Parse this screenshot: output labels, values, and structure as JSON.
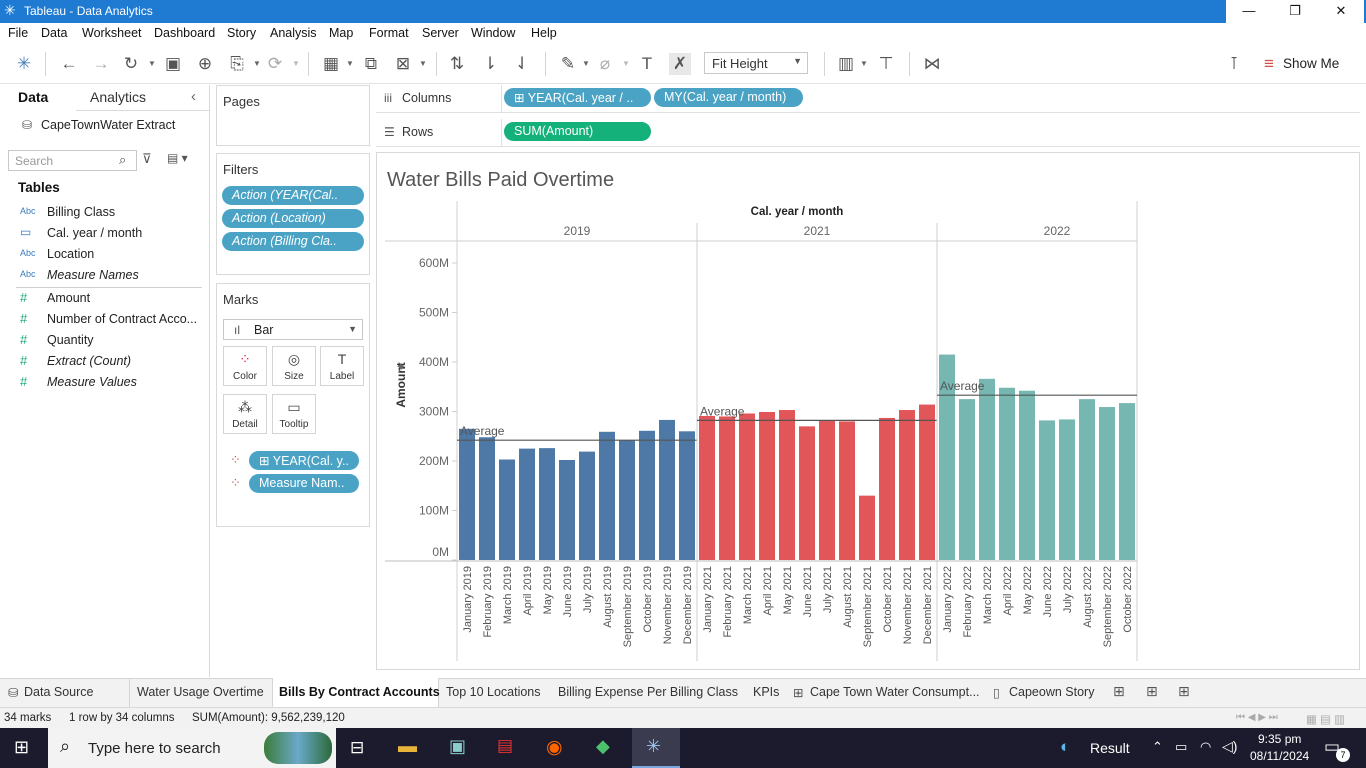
{
  "window": {
    "title": "Tableau - Data Analytics"
  },
  "menu": [
    "File",
    "Data",
    "Worksheet",
    "Dashboard",
    "Story",
    "Analysis",
    "Map",
    "Format",
    "Server",
    "Window",
    "Help"
  ],
  "toolbar": {
    "fit": "Fit Height",
    "show_me": "Show Me"
  },
  "leftpane": {
    "tab_data": "Data",
    "tab_analytics": "Analytics",
    "datasource": "CapeTownWater Extract",
    "search_placeholder": "Search",
    "tables_header": "Tables",
    "dimensions": [
      {
        "type": "Abc",
        "label": "Billing Class"
      },
      {
        "type": "cal",
        "label": "Cal. year / month"
      },
      {
        "type": "Abc",
        "label": "Location"
      },
      {
        "type": "Abc",
        "label": "Measure Names"
      }
    ],
    "measures": [
      {
        "label": "Amount"
      },
      {
        "label": "Number of Contract Acco..."
      },
      {
        "label": "Quantity"
      },
      {
        "label": "Extract (Count)"
      },
      {
        "label": "Measure Values"
      }
    ]
  },
  "shelves": {
    "pages": "Pages",
    "filters_title": "Filters",
    "filters": [
      "Action (YEAR(Cal..",
      "Action (Location)",
      "Action (Billing Cla.."
    ],
    "marks_title": "Marks",
    "mark_type": "Bar",
    "mark_buttons": [
      "Color",
      "Size",
      "Label",
      "Detail",
      "Tooltip"
    ],
    "mark_pills": [
      "YEAR(Cal. y..",
      "Measure Nam.."
    ],
    "columns_label": "Columns",
    "columns": [
      "YEAR(Cal. year / ..",
      "MY(Cal. year / month)"
    ],
    "rows_label": "Rows",
    "rows": [
      "SUM(Amount)"
    ]
  },
  "chart_data": {
    "type": "bar",
    "title": "Water Bills Paid Overtime",
    "header": "Cal. year / month",
    "ylabel": "Amount",
    "ylim": [
      0,
      600
    ],
    "yticks": [
      "0M",
      "100M",
      "200M",
      "300M",
      "400M",
      "500M",
      "600M"
    ],
    "reference_label": "Average",
    "groups": [
      {
        "year": "2019",
        "color": "#4e79a7",
        "average": 242,
        "categories": [
          "January 2019",
          "February 2019",
          "March 2019",
          "April 2019",
          "May 2019",
          "June 2019",
          "July 2019",
          "August 2019",
          "September 2019",
          "October 2019",
          "November 2019",
          "December 2019"
        ],
        "values": [
          265,
          248,
          203,
          225,
          226,
          202,
          219,
          259,
          242,
          261,
          283,
          260
        ]
      },
      {
        "year": "2021",
        "color": "#e15759",
        "average": 282,
        "categories": [
          "January 2021",
          "February 2021",
          "March 2021",
          "April 2021",
          "May 2021",
          "June 2021",
          "July 2021",
          "August 2021",
          "September 2021",
          "October 2021",
          "November 2021",
          "December 2021"
        ],
        "values": [
          291,
          290,
          296,
          299,
          303,
          270,
          282,
          280,
          130,
          287,
          303,
          314
        ]
      },
      {
        "year": "2022",
        "color": "#76b7b2",
        "average": 333,
        "categories": [
          "January 2022",
          "February 2022",
          "March 2022",
          "April 2022",
          "May 2022",
          "June 2022",
          "July 2022",
          "August 2022",
          "September 2022",
          "October 2022"
        ],
        "values": [
          415,
          325,
          366,
          348,
          342,
          282,
          284,
          325,
          309,
          317
        ]
      }
    ]
  },
  "sheet_tabs": [
    "Data Source",
    "Water Usage Overtime",
    "Bills By Contract Accounts",
    "Top 10 Locations",
    "Billing Expense Per Billing Class",
    "KPIs",
    "Cape Town Water Consumpt...",
    "Capeown Story"
  ],
  "status": {
    "marks": "34 marks",
    "shape": "1 row by 34 columns",
    "sum": "SUM(Amount): 9,562,239,120"
  },
  "taskbar": {
    "search": "Type here to search",
    "result": "Result",
    "time": "9:35 pm",
    "date": "08/11/2024",
    "notif_count": "7"
  }
}
